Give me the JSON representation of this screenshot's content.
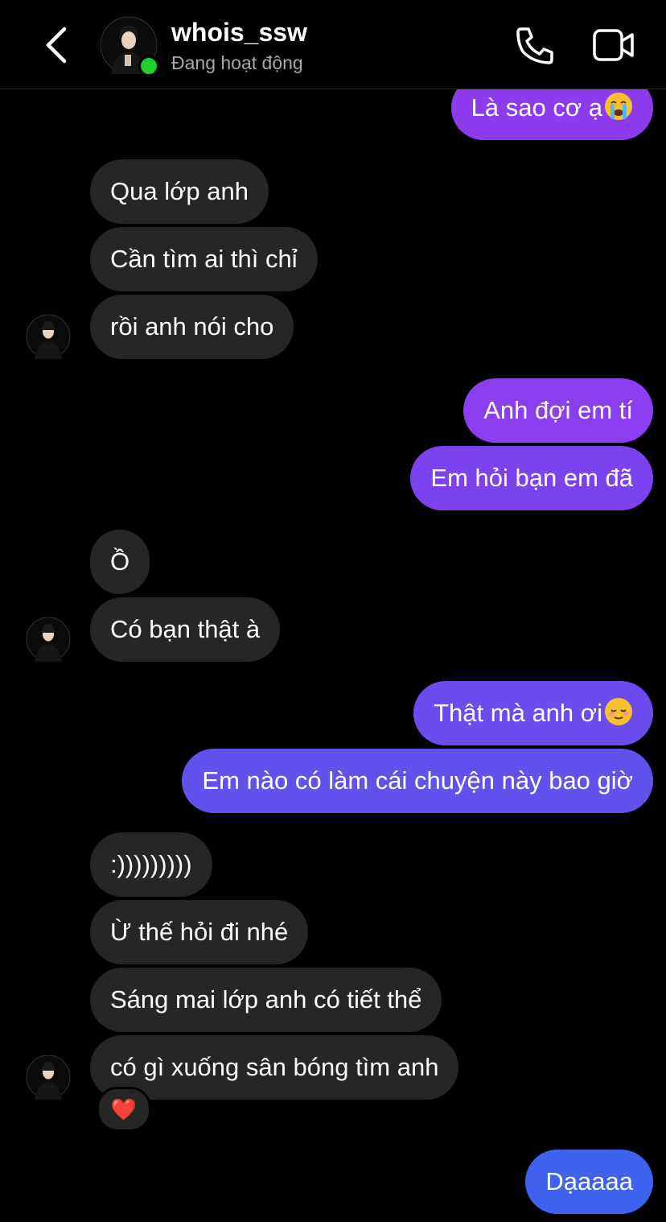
{
  "header": {
    "username": "whois_ssw",
    "status": "Đang hoạt động",
    "icons": [
      "back-icon",
      "phone-icon",
      "video-call-icon"
    ]
  },
  "messages": [
    {
      "from": "me",
      "text": "Là sao cơ ạ",
      "emoji": "crying-face-emoji",
      "color": "#8e3bf0"
    },
    {
      "from": "them",
      "text": "Qua lớp anh"
    },
    {
      "from": "them",
      "text": "Cần tìm ai thì chỉ"
    },
    {
      "from": "them",
      "text": "rồi anh nói cho"
    },
    {
      "from": "me",
      "text": "Anh đợi em tí",
      "color": "#8a3ef0"
    },
    {
      "from": "me",
      "text": "Em hỏi bạn em đã",
      "color": "#7d42f0"
    },
    {
      "from": "them",
      "text": "Ồ"
    },
    {
      "from": "them",
      "text": "Có bạn thật à"
    },
    {
      "from": "me",
      "text": "Thật mà anh ơi",
      "emoji": "relieved-face-emoji",
      "color": "#6c4bef"
    },
    {
      "from": "me",
      "text": "Em nào có làm cái chuyện này bao giờ",
      "color": "#6152ee"
    },
    {
      "from": "them",
      "text": ":)))))))))"
    },
    {
      "from": "them",
      "text": "Ừ thế hỏi đi nhé"
    },
    {
      "from": "them",
      "text": "Sáng mai lớp anh có tiết thể"
    },
    {
      "from": "them",
      "text": "có gì xuống sân bóng tìm anh",
      "reaction": "❤️"
    },
    {
      "from": "me",
      "text": "Dạaaaa",
      "color": "#3f63ee"
    }
  ],
  "colors": {
    "incoming_bubble": "#262626",
    "online_dot": "#1fd130",
    "background": "#000000"
  }
}
